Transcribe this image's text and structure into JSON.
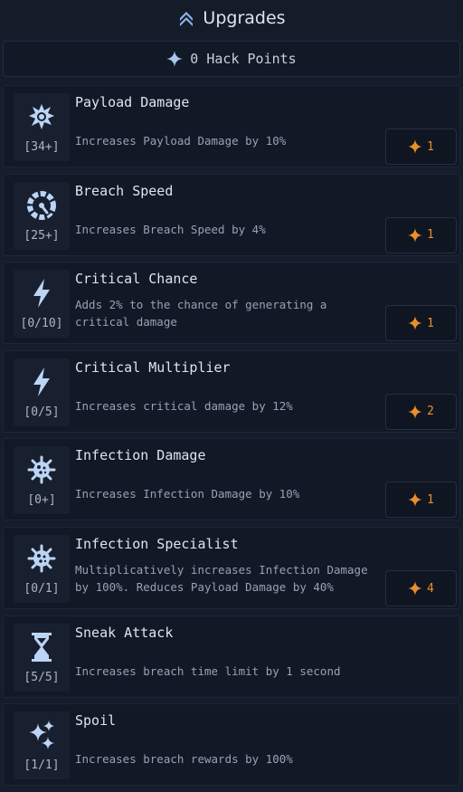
{
  "header": {
    "title": "Upgrades",
    "icon": "double-chevron-up-icon"
  },
  "points": {
    "label": "0 Hack Points",
    "icon": "sparkle-icon"
  },
  "colors": {
    "cost": "#e8902b",
    "icon": "#bcd4f5",
    "background": "#151c2b"
  },
  "upgrades": [
    {
      "name": "Payload Damage",
      "level": "[34+]",
      "desc_lines": [
        "Increases Payload Damage by 10%"
      ],
      "cost": "1",
      "icon": "burst-icon"
    },
    {
      "name": "Breach Speed",
      "level": "[25+]",
      "desc_lines": [
        "Increases Breach Speed by 4%"
      ],
      "cost": "1",
      "icon": "speedometer-icon"
    },
    {
      "name": "Critical Chance",
      "level": "[0/10]",
      "desc_lines": [
        "Adds 2% to the chance of generating a",
        "critical damage"
      ],
      "cost": "1",
      "icon": "lightning-icon"
    },
    {
      "name": "Critical Multiplier",
      "level": "[0/5]",
      "desc_lines": [
        "Increases critical damage by 12%"
      ],
      "cost": "2",
      "icon": "lightning-icon"
    },
    {
      "name": "Infection Damage",
      "level": "[0+]",
      "desc_lines": [
        "Increases Infection Damage by 10%"
      ],
      "cost": "1",
      "icon": "virus-icon"
    },
    {
      "name": "Infection Specialist",
      "level": "[0/1]",
      "desc_lines": [
        "Multiplicatively increases Infection Damage",
        "by 100%. Reduces Payload Damage by 40%"
      ],
      "cost": "4",
      "icon": "virus-icon"
    },
    {
      "name": "Sneak Attack",
      "level": "[5/5]",
      "desc_lines": [
        "Increases breach time limit by 1 second"
      ],
      "cost": null,
      "icon": "hourglass-icon"
    },
    {
      "name": "Spoil",
      "level": "[1/1]",
      "desc_lines": [
        "Increases breach rewards by 100%"
      ],
      "cost": null,
      "icon": "sparkles-icon"
    }
  ]
}
